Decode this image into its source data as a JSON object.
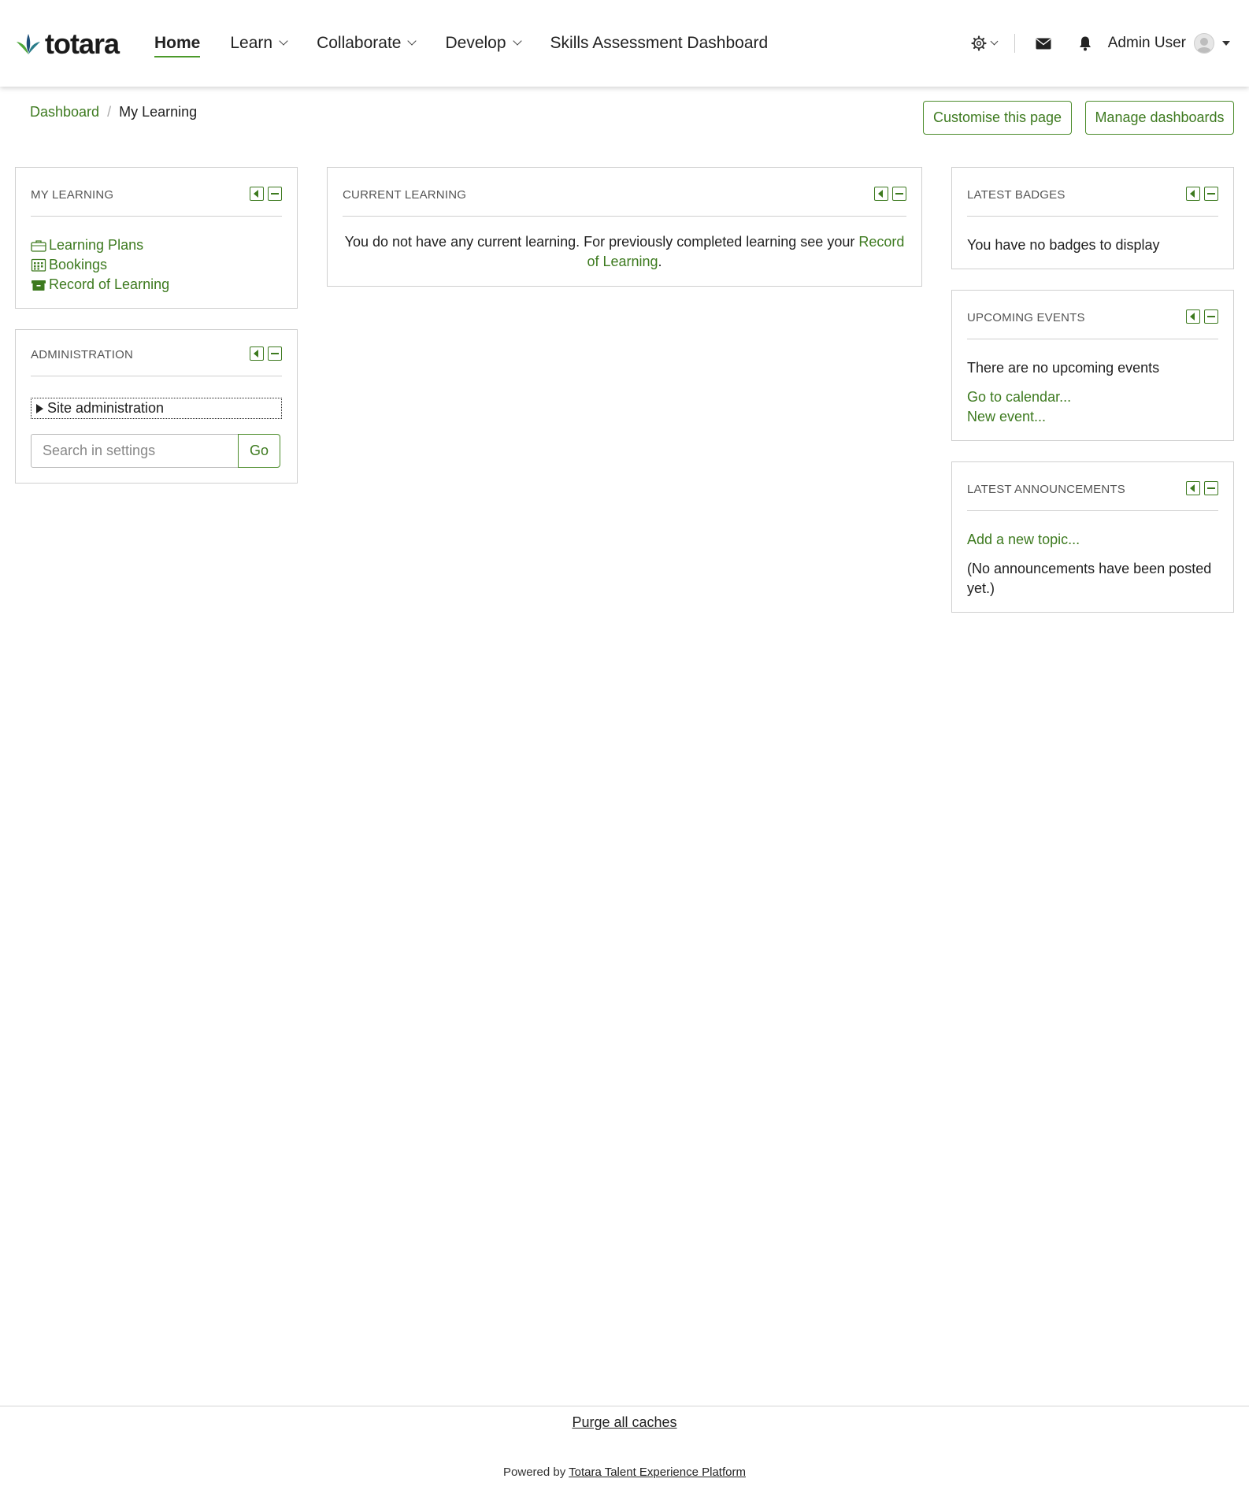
{
  "brand": {
    "name": "totara"
  },
  "nav": {
    "home": "Home",
    "learn": "Learn",
    "collaborate": "Collaborate",
    "develop": "Develop",
    "skills": "Skills Assessment Dashboard"
  },
  "user": {
    "name": "Admin User"
  },
  "breadcrumb": {
    "parent": "Dashboard",
    "separator": "/",
    "current": "My Learning"
  },
  "actions": {
    "customise": "Customise this page",
    "manage": "Manage dashboards"
  },
  "blocks": {
    "my_learning": {
      "title": "MY LEARNING",
      "items": [
        "Learning Plans",
        "Bookings",
        "Record of Learning"
      ]
    },
    "administration": {
      "title": "ADMINISTRATION",
      "site_admin": "Site administration",
      "search_placeholder": "Search in settings",
      "go": "Go"
    },
    "current_learning": {
      "title": "CURRENT LEARNING",
      "message": "You do not have any current learning. For previously completed learning see your ",
      "link": "Record of Learning",
      "end": "."
    },
    "latest_badges": {
      "title": "LATEST BADGES",
      "message": "You have no badges to display"
    },
    "upcoming_events": {
      "title": "UPCOMING EVENTS",
      "message": "There are no upcoming events",
      "calendar_link": "Go to calendar...",
      "new_event_link": "New event..."
    },
    "latest_announcements": {
      "title": "LATEST ANNOUNCEMENTS",
      "add_topic": "Add a new topic...",
      "message": "(No announcements have been posted yet.)"
    }
  },
  "footer": {
    "purge": "Purge all caches",
    "powered_prefix": "Powered by ",
    "powered_link": "Totara Talent Experience Platform"
  },
  "colors": {
    "accent": "#3d7a1f",
    "brand_green": "#4c9a2a"
  }
}
